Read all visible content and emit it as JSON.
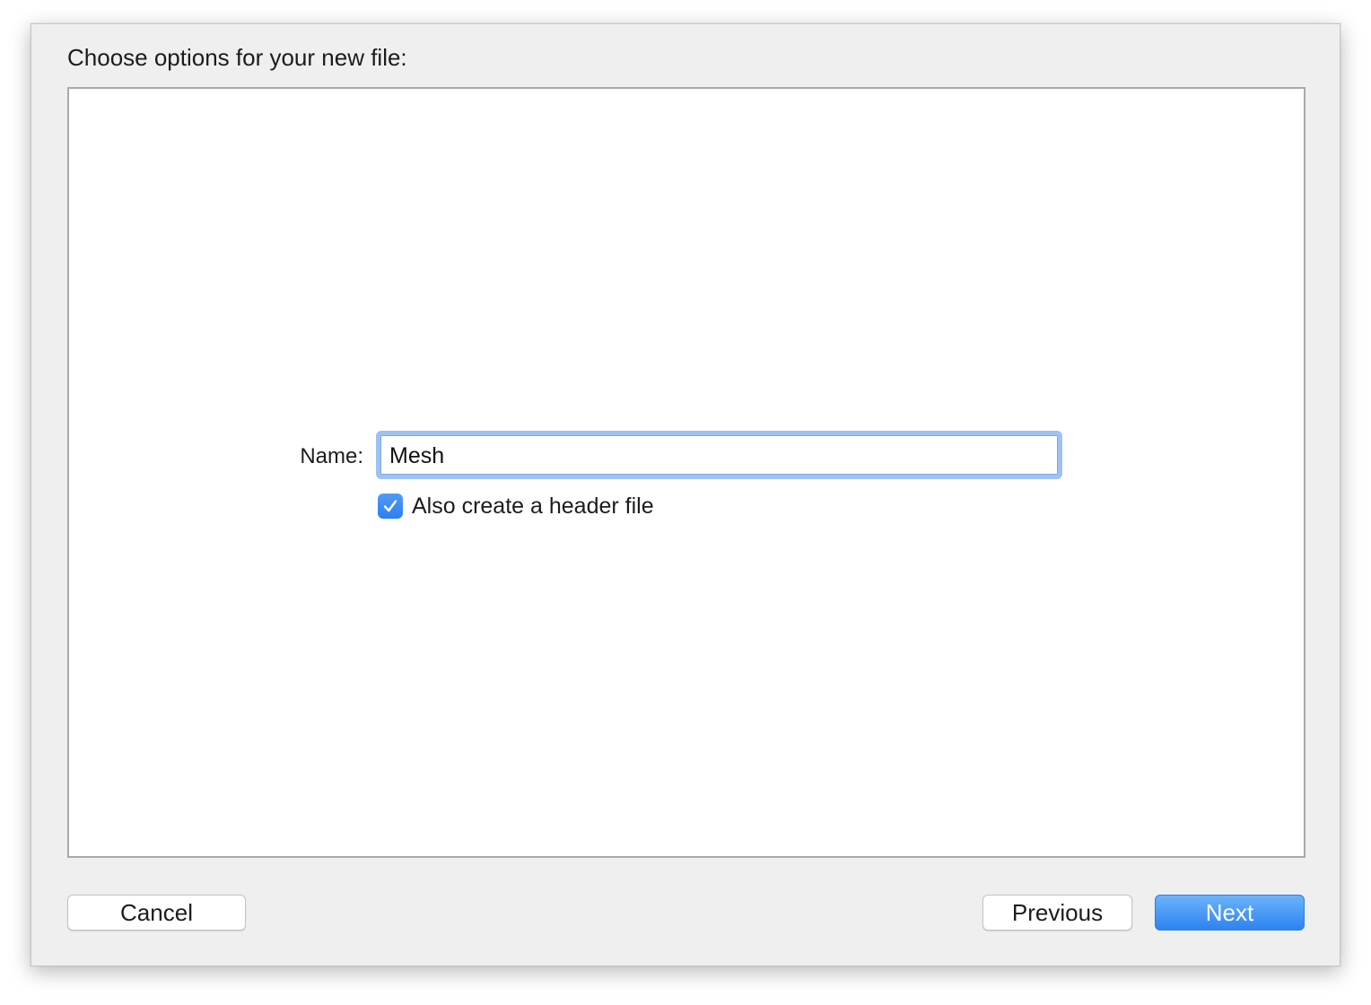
{
  "dialog": {
    "heading": "Choose options for your new file:"
  },
  "form": {
    "name_label": "Name:",
    "name_value": "Mesh",
    "header_checkbox": {
      "label": "Also create a header file",
      "checked": true
    }
  },
  "buttons": {
    "cancel_label": "Cancel",
    "previous_label": "Previous",
    "next_label": "Next"
  },
  "icons": {
    "checkbox": "checkmark-icon"
  },
  "colors": {
    "accent": "#2e7ff1",
    "focus_ring": "#9dc2f3",
    "window_bg": "#efefef"
  }
}
